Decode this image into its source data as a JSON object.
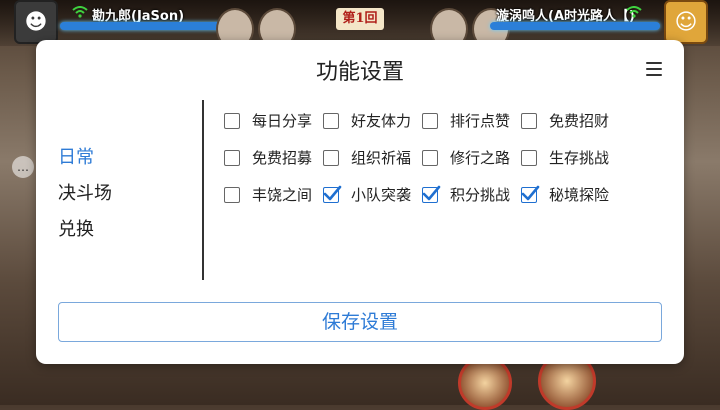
{
  "hud": {
    "left_player": "勘九郎(JaSon)",
    "right_player": "漩涡鸣人(A时光路人【)",
    "round": "第1回"
  },
  "dialog": {
    "title": "功能设置",
    "menu_icon": "hamburger-menu-icon",
    "sidebar": [
      {
        "label": "日常",
        "active": true
      },
      {
        "label": "决斗场",
        "active": false
      },
      {
        "label": "兑换",
        "active": false
      }
    ],
    "options": [
      [
        {
          "label": "每日分享",
          "checked": false
        },
        {
          "label": "好友体力",
          "checked": false
        },
        {
          "label": "排行点赞",
          "checked": false
        },
        {
          "label": "免费招财",
          "checked": false
        }
      ],
      [
        {
          "label": "免费招募",
          "checked": false
        },
        {
          "label": "组织祈福",
          "checked": false
        },
        {
          "label": "修行之路",
          "checked": false
        },
        {
          "label": "生存挑战",
          "checked": false
        }
      ],
      [
        {
          "label": "丰饶之间",
          "checked": false
        },
        {
          "label": "小队突袭",
          "checked": true
        },
        {
          "label": "积分挑战",
          "checked": true
        },
        {
          "label": "秘境探险",
          "checked": true
        }
      ]
    ],
    "save_label": "保存设置"
  },
  "colors": {
    "accent": "#2e7bd6",
    "check": "#1f6fd0",
    "hp": "#2b7fd8"
  }
}
